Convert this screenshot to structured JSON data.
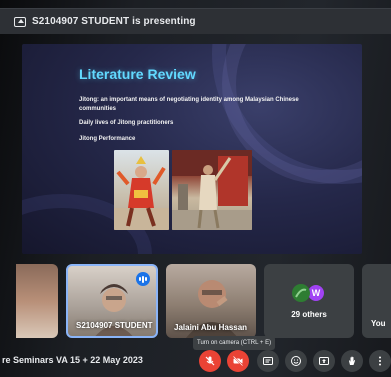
{
  "presenting_banner": {
    "text": "S2104907 STUDENT is presenting",
    "icon": "present-to-all-icon"
  },
  "slide": {
    "title": "Literature Review",
    "bullets": [
      "Jitong: an important means of negotiating identity among Malaysian Chinese communities",
      "Daily lives of Jitong practitioners",
      "Jitong Performance"
    ],
    "accent_color": "#62d9ff"
  },
  "participants": [
    {
      "name": "",
      "speaking": false
    },
    {
      "name": "S2104907 STUDENT",
      "speaking": true
    },
    {
      "name": "Jalaini Abu Hassan",
      "speaking": false
    },
    {
      "name": "29 others",
      "avatars": [
        "",
        "W"
      ]
    },
    {
      "name": "You"
    }
  ],
  "tooltip": {
    "text": "Turn on camera (CTRL + E)"
  },
  "meeting": {
    "title": "re Seminars VA 15 + 22 May 2023"
  },
  "controls": [
    {
      "name": "microphone-off",
      "icon": "mic-off-icon",
      "state": "off"
    },
    {
      "name": "camera-off",
      "icon": "videocam-off-icon",
      "state": "off"
    },
    {
      "name": "captions",
      "icon": "closed-caption-icon"
    },
    {
      "name": "reactions",
      "icon": "emoji-icon"
    },
    {
      "name": "present-now",
      "icon": "present-to-all-icon"
    },
    {
      "name": "raise-hand",
      "icon": "hand-icon"
    },
    {
      "name": "more-options",
      "icon": "more-vert-icon"
    }
  ],
  "colors": {
    "danger": "#ea4335",
    "speaking_border": "#8ab4f8",
    "control_bg": "#3c4043"
  }
}
